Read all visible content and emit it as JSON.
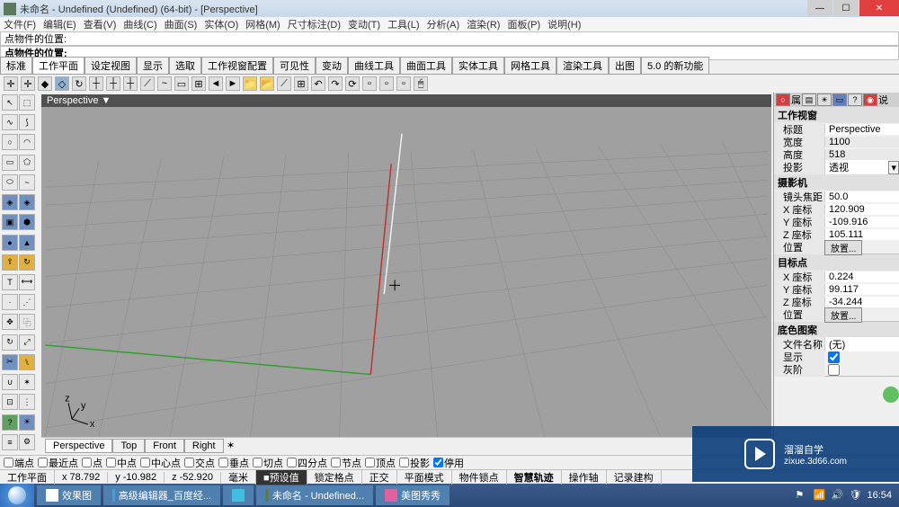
{
  "window": {
    "title": "未命名 - Undefined (Undefined) (64-bit) - [Perspective]"
  },
  "menu": [
    "文件(F)",
    "编辑(E)",
    "查看(V)",
    "曲线(C)",
    "曲面(S)",
    "实体(O)",
    "网格(M)",
    "尺寸标注(D)",
    "变动(T)",
    "工具(L)",
    "分析(A)",
    "渲染(R)",
    "面板(P)",
    "说明(H)"
  ],
  "input1_label": "点物件的位置:",
  "input2_label": "点物件的位置:",
  "ribbon_tabs": [
    "标准",
    "工作平面",
    "设定视图",
    "显示",
    "选取",
    "工作视窗配置",
    "可见性",
    "变动",
    "曲线工具",
    "曲面工具",
    "实体工具",
    "网格工具",
    "渲染工具",
    "出图",
    "5.0 的新功能"
  ],
  "viewport_label": "Perspective ▼",
  "view_tabs": [
    "Perspective",
    "Top",
    "Front",
    "Right"
  ],
  "props": {
    "panel_tab": "属",
    "panel_tab_suffix": "说",
    "section1": "工作视窗",
    "title_label": "标题",
    "title_val": "Perspective",
    "width_label": "宽度",
    "width_val": "1100",
    "height_label": "高度",
    "height_val": "518",
    "proj_label": "投影",
    "proj_val": "透视",
    "section2": "摄影机",
    "focal_label": "镜头焦距",
    "focal_val": "50.0",
    "camx_label": "X 座标",
    "camx_val": "120.909",
    "camy_label": "Y 座标",
    "camy_val": "-109.916",
    "camz_label": "Z 座标",
    "camz_val": "105.111",
    "pos_label": "位置",
    "pos_btn": "放置...",
    "section3": "目标点",
    "tx_label": "X 座标",
    "tx_val": "0.224",
    "ty_label": "Y 座标",
    "ty_val": "99.117",
    "tz_label": "Z 座标",
    "tz_val": "-34.244",
    "tpos_label": "位置",
    "tpos_btn": "放置...",
    "section4": "底色图案",
    "file_label": "文件名称",
    "file_val": "(无)",
    "show_label": "显示",
    "gray_label": "灰阶"
  },
  "osnap": [
    "端点",
    "最近点",
    "点",
    "中点",
    "中心点",
    "交点",
    "垂点",
    "切点",
    "四分点",
    "节点",
    "顶点"
  ],
  "osnap_extra": {
    "proj": "投影",
    "disable": "停用"
  },
  "status": {
    "cplane": "工作平面",
    "x": "x 78.792",
    "y": "y -10.982",
    "z": "z -52.920",
    "unit": "毫米",
    "default": "预设值",
    "snap": "锁定格点",
    "ortho": "正交",
    "planar": "平面模式",
    "lock": "物件锁点",
    "smart": "智慧轨迹",
    "axis": "操作轴",
    "record": "记录建构"
  },
  "taskbar": {
    "items": [
      "效果图",
      "高级编辑器_百度经...",
      "",
      "未命名 - Undefined...",
      "美图秀秀"
    ],
    "clock": "16:54"
  },
  "watermark": {
    "brand": "溜溜自学",
    "url": "zixue.3d66.com"
  }
}
